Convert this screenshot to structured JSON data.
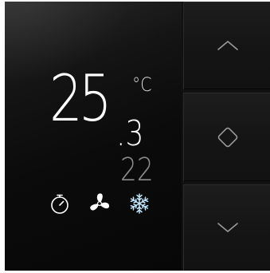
{
  "display": {
    "current_temp_whole": "25",
    "current_temp_decimal": ".3",
    "unit": "°C",
    "setpoint": "22"
  },
  "status_icons": [
    {
      "name": "timer-icon",
      "color": "#ffffff"
    },
    {
      "name": "fan-icon",
      "color": "#ffffff"
    },
    {
      "name": "snowflake-cooling-icon",
      "color": "#bfe6ff"
    }
  ],
  "buttons": {
    "up": {
      "icon": "chevron-up-icon"
    },
    "mode": {
      "icon": "diamond-icon"
    },
    "down": {
      "icon": "chevron-down-icon"
    }
  },
  "colors": {
    "screen": "#0b0b0b",
    "text_primary": "#ffffff",
    "text_setpoint": "#8c8c8c",
    "cooling_accent": "#bfe6ff",
    "button_icon": "#9a9a9a"
  }
}
